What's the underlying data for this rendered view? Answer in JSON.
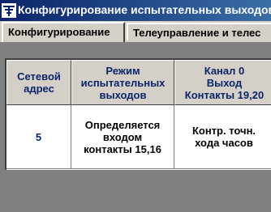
{
  "window": {
    "title": "Конфигурирование испытательных выходов"
  },
  "tabs": [
    {
      "label": "Конфигурирование",
      "active": true
    },
    {
      "label": "Телеуправление и телес",
      "active": false
    }
  ],
  "table": {
    "headers": [
      "Сетевой\nадрес",
      "Режим\nиспытательных\nвыходов",
      "Канал 0\nВыход\nКонтакты 19,20"
    ],
    "rows": [
      [
        "5",
        "Определяется\nвходом\nконтакты 15,16",
        "Контр. точн.\nхода часов"
      ]
    ]
  },
  "colors": {
    "title_bar": "#0a246a",
    "header_text": "#0a246a",
    "panel_bg": "#808080"
  }
}
